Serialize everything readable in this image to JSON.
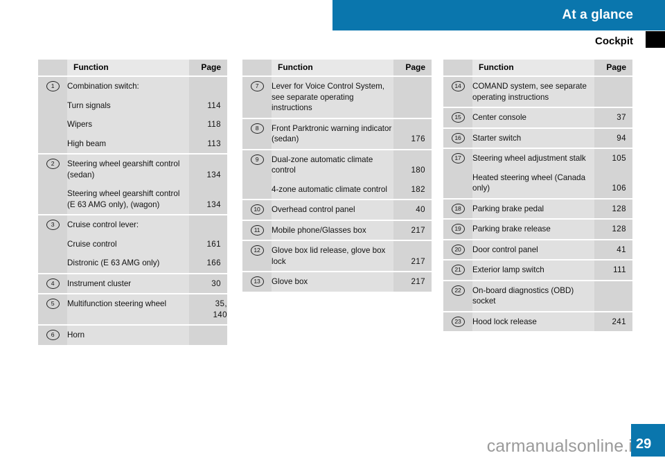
{
  "header": {
    "title": "At a glance",
    "subtitle": "Cockpit",
    "bar_color": "#0a76ad",
    "tab_marker_color": "#000000"
  },
  "table_headers": {
    "function": "Function",
    "page": "Page"
  },
  "columns": [
    {
      "id": "column-1",
      "groups": [
        {
          "marker": "1",
          "rows": [
            {
              "function": "Combination switch:",
              "page": ""
            },
            {
              "function": "Turn signals",
              "page": "114"
            },
            {
              "function": "Wipers",
              "page": "118"
            },
            {
              "function": "High beam",
              "page": "113"
            }
          ]
        },
        {
          "marker": "2",
          "rows": [
            {
              "function": "Steering wheel gearshift control (sedan)",
              "page": "134"
            },
            {
              "function": "Steering wheel gearshift control\n(E 63 AMG only), (wagon)",
              "page": "134"
            }
          ]
        },
        {
          "marker": "3",
          "rows": [
            {
              "function": "Cruise control lever:",
              "page": ""
            },
            {
              "function": "Cruise control",
              "page": "161"
            },
            {
              "function": "Distronic (E 63 AMG only)",
              "page": "166"
            }
          ]
        },
        {
          "marker": "4",
          "rows": [
            {
              "function": "Instrument cluster",
              "page": "30"
            }
          ]
        },
        {
          "marker": "5",
          "rows": [
            {
              "function": "Multifunction steering wheel",
              "page": "35,\n140"
            }
          ]
        },
        {
          "marker": "6",
          "rows": [
            {
              "function": "Horn",
              "page": ""
            }
          ]
        }
      ]
    },
    {
      "id": "column-2",
      "groups": [
        {
          "marker": "7",
          "rows": [
            {
              "function": "Lever for Voice Control System, see separate operating instructions",
              "page": ""
            }
          ]
        },
        {
          "marker": "8",
          "rows": [
            {
              "function": "Front Parktronic warning indicator (sedan)",
              "page": "176"
            }
          ]
        },
        {
          "marker": "9",
          "rows": [
            {
              "function": "Dual-zone automatic climate control",
              "page": "180"
            },
            {
              "function": "4-zone automatic climate control",
              "page": "182"
            }
          ]
        },
        {
          "marker": "10",
          "rows": [
            {
              "function": "Overhead control panel",
              "page": "40"
            }
          ]
        },
        {
          "marker": "11",
          "rows": [
            {
              "function": "Mobile phone/Glasses box",
              "page": "217"
            }
          ]
        },
        {
          "marker": "12",
          "rows": [
            {
              "function": "Glove box lid release, glove box lock",
              "page": "217"
            }
          ]
        },
        {
          "marker": "13",
          "rows": [
            {
              "function": "Glove box",
              "page": "217"
            }
          ]
        }
      ]
    },
    {
      "id": "column-3",
      "groups": [
        {
          "marker": "14",
          "rows": [
            {
              "function": "COMAND system, see separate operating instructions",
              "page": ""
            }
          ]
        },
        {
          "marker": "15",
          "rows": [
            {
              "function": "Center console",
              "page": "37"
            }
          ]
        },
        {
          "marker": "16",
          "rows": [
            {
              "function": "Starter switch",
              "page": "94"
            }
          ]
        },
        {
          "marker": "17",
          "rows": [
            {
              "function": "Steering wheel adjustment stalk",
              "page": "105"
            },
            {
              "function": "Heated steering wheel (Canada only)",
              "page": "106"
            }
          ]
        },
        {
          "marker": "18",
          "rows": [
            {
              "function": "Parking brake pedal",
              "page": "128"
            }
          ]
        },
        {
          "marker": "19",
          "rows": [
            {
              "function": "Parking brake release",
              "page": "128"
            }
          ]
        },
        {
          "marker": "20",
          "rows": [
            {
              "function": "Door control panel",
              "page": "41"
            }
          ]
        },
        {
          "marker": "21",
          "rows": [
            {
              "function": "Exterior lamp switch",
              "page": "111"
            }
          ]
        },
        {
          "marker": "22",
          "rows": [
            {
              "function": "On-board diagnostics (OBD) socket",
              "page": ""
            }
          ]
        },
        {
          "marker": "23",
          "rows": [
            {
              "function": "Hood lock release",
              "page": "241"
            }
          ]
        }
      ]
    }
  ],
  "footer": {
    "page_number": "29",
    "watermark": "carmanualsonline.info"
  }
}
